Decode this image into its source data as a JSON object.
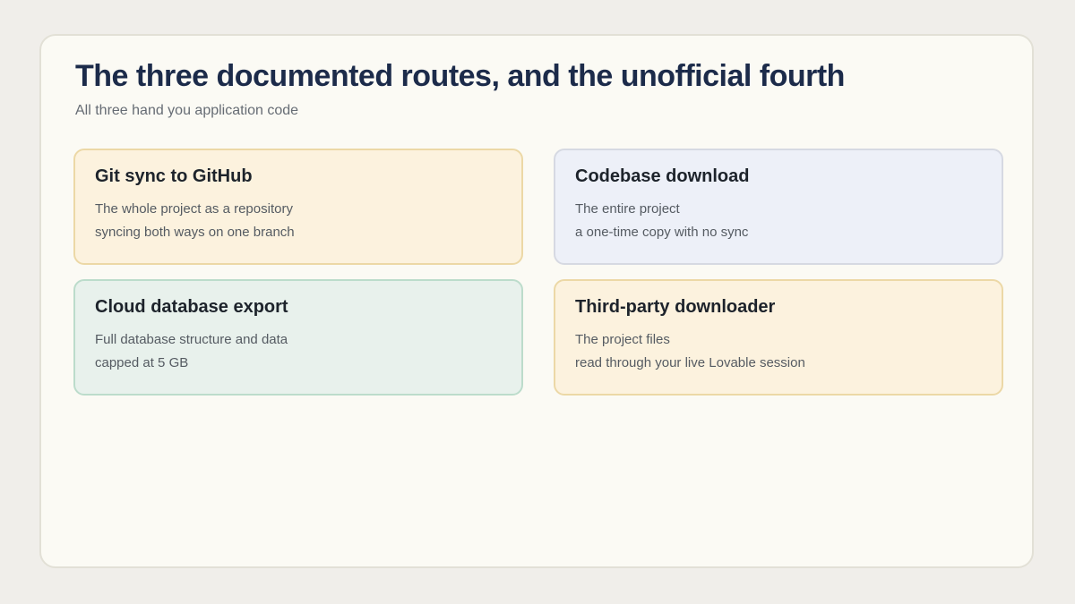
{
  "header": {
    "title": "The three documented routes, and the unofficial fourth",
    "subtitle": "All three hand you application code"
  },
  "cards": [
    {
      "title": "Git sync to GitHub",
      "lines": [
        "The whole project as a repository",
        "syncing both ways on one branch"
      ],
      "background": "#fcf2de",
      "border": "#ecd8a6"
    },
    {
      "title": "Codebase download",
      "lines": [
        "The entire project",
        "a one-time copy with no sync"
      ],
      "background": "#edf0f8",
      "border": "#d6d9e2"
    },
    {
      "title": "Cloud database export",
      "lines": [
        "Full database structure and data",
        "capped at 5 GB"
      ],
      "background": "#e8f1ec",
      "border": "#bcdccb"
    },
    {
      "title": "Third-party downloader",
      "lines": [
        "The project files",
        "read through your live Lovable session"
      ],
      "background": "#fcf2de",
      "border": "#ecd8a6"
    }
  ]
}
